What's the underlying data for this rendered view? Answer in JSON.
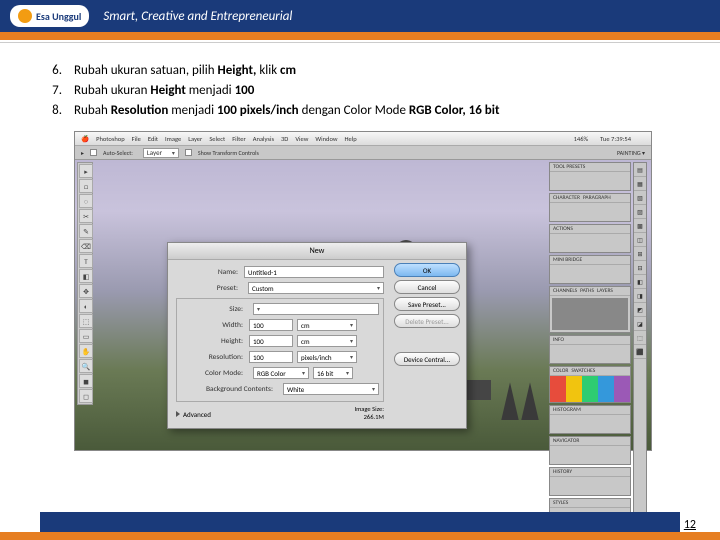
{
  "header": {
    "logo_name": "Esa Unggul",
    "tagline": "Smart, Creative and Entrepreneurial"
  },
  "instructions": [
    {
      "n": "6.",
      "prefix": "Rubah ukuran satuan, pilih ",
      "b1": "Height,",
      "mid": " klik ",
      "b2": "cm"
    },
    {
      "n": "7.",
      "prefix": "Rubah ukuran ",
      "b1": "Height",
      "mid": " menjadi ",
      "b2": "100"
    },
    {
      "n": "8.",
      "prefix": "Rubah ",
      "b1": "Resolution",
      "mid": " menjadi ",
      "b2": "100 pixels/inch",
      "mid2": " dengan Color Mode ",
      "b3": "RGB Color, 16 bit"
    }
  ],
  "mac_menu": [
    "Photoshop",
    "File",
    "Edit",
    "Image",
    "Layer",
    "Select",
    "Filter",
    "Analysis",
    "3D",
    "View",
    "Window",
    "Help"
  ],
  "mac_right": [
    "146%",
    "Tue 7:39:54"
  ],
  "optbar": {
    "auto": "Auto-Select:",
    "layer": "Layer",
    "show": "Show Transform Controls",
    "mode": "PAINTING ▾"
  },
  "tools": [
    "▸",
    "□",
    "◌",
    "✂",
    "✎",
    "⌫",
    "T",
    "◧",
    "✥",
    "◐",
    "⬚",
    "▭",
    "✋",
    "🔍",
    "◼",
    "◻"
  ],
  "right_strip": [
    "▤",
    "▦",
    "▧",
    "▨",
    "▩",
    "◫",
    "⊞",
    "⊟",
    "◧",
    "◨",
    "◩",
    "◪",
    "⬚",
    "⬛"
  ],
  "panels": {
    "p1": [
      "TOOL PRESETS"
    ],
    "p2": [
      "CHARACTER",
      "PARAGRAPH"
    ],
    "p3": [
      "ACTIONS"
    ],
    "p4": [
      "MINI BRIDGE"
    ],
    "p5": [
      "CHANNELS",
      "PATHS",
      "LAYERS"
    ],
    "p6": [
      "INFO"
    ],
    "p7": [
      "COLOR",
      "SWATCHES"
    ],
    "p8": [
      "HISTOGRAM"
    ],
    "p9": [
      "NAVIGATOR"
    ],
    "p10": [
      "HISTORY"
    ],
    "p11": [
      "STYLES"
    ]
  },
  "dialog": {
    "title": "New",
    "name_lbl": "Name:",
    "name_val": "Untitled-1",
    "preset_lbl": "Preset:",
    "preset_val": "Custom",
    "size_lbl": "Size:",
    "size_val": "",
    "width_lbl": "Width:",
    "width_val": "100",
    "width_unit": "cm",
    "height_lbl": "Height:",
    "height_val": "100",
    "height_unit": "cm",
    "res_lbl": "Resolution:",
    "res_val": "100",
    "res_unit": "pixels/inch",
    "mode_lbl": "Color Mode:",
    "mode_val": "RGB Color",
    "mode_bits": "16 bit",
    "bg_lbl": "Background Contents:",
    "bg_val": "White",
    "adv": "Advanced",
    "imgsize_lbl": "Image Size:",
    "imgsize_val": "266.1M",
    "btn_ok": "OK",
    "btn_cancel": "Cancel",
    "btn_save": "Save Preset...",
    "btn_del": "Delete Preset...",
    "btn_dev": "Device Central..."
  },
  "page_number": "12"
}
